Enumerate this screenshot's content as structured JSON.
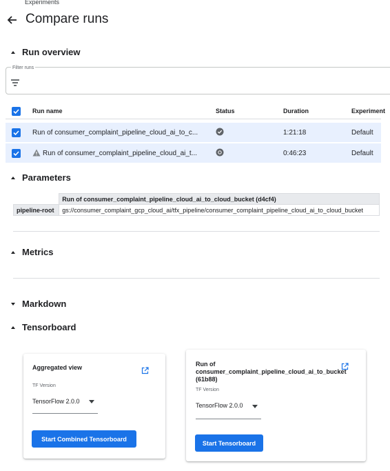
{
  "header": {
    "breadcrumb": "Experiments",
    "title": "Compare runs"
  },
  "sections": {
    "run_overview": "Run overview",
    "parameters": "Parameters",
    "metrics": "Metrics",
    "markdown": "Markdown",
    "tensorboard": "Tensorboard"
  },
  "filter": {
    "label": "Filter runs"
  },
  "runs_table": {
    "headers": {
      "name": "Run name",
      "status": "Status",
      "duration": "Duration",
      "experiment": "Experiment"
    },
    "rows": [
      {
        "name": "Run of consumer_complaint_pipeline_cloud_ai_to_c...",
        "status_icon": "check-circle-icon",
        "duration": "1:21:18",
        "experiment": "Default",
        "warning": false
      },
      {
        "name": "Run of consumer_complaint_pipeline_cloud_ai_t...",
        "status_icon": "running-icon",
        "duration": "0:46:23",
        "experiment": "Default",
        "warning": true
      }
    ]
  },
  "parameters_table": {
    "column_header": "Run of consumer_complaint_pipeline_cloud_ai_to_cloud_bucket (d4cf4)",
    "rows": [
      {
        "key": "pipeline-root",
        "value": "gs://consumer_complaint_gcp_cloud_ai/tfx_pipeline/consumer_complaint_pipeline_cloud_ai_to_cloud_bucket"
      }
    ]
  },
  "tensorboard": {
    "cards": [
      {
        "title": "Aggregated view",
        "tf_label": "TF Version",
        "tf_value": "TensorFlow 2.0.0",
        "button": "Start Combined Tensorboard"
      },
      {
        "title_line1": "Run of",
        "title_line2": "consumer_complaint_pipeline_cloud_ai_to_bucket",
        "title_line3": "(61b88)",
        "tf_label": "TF Version",
        "tf_value": "TensorFlow 2.0.0",
        "button": "Start Tensorboard"
      }
    ]
  },
  "colors": {
    "accent": "#1a73e8",
    "row_selected": "#e8f0fe"
  }
}
